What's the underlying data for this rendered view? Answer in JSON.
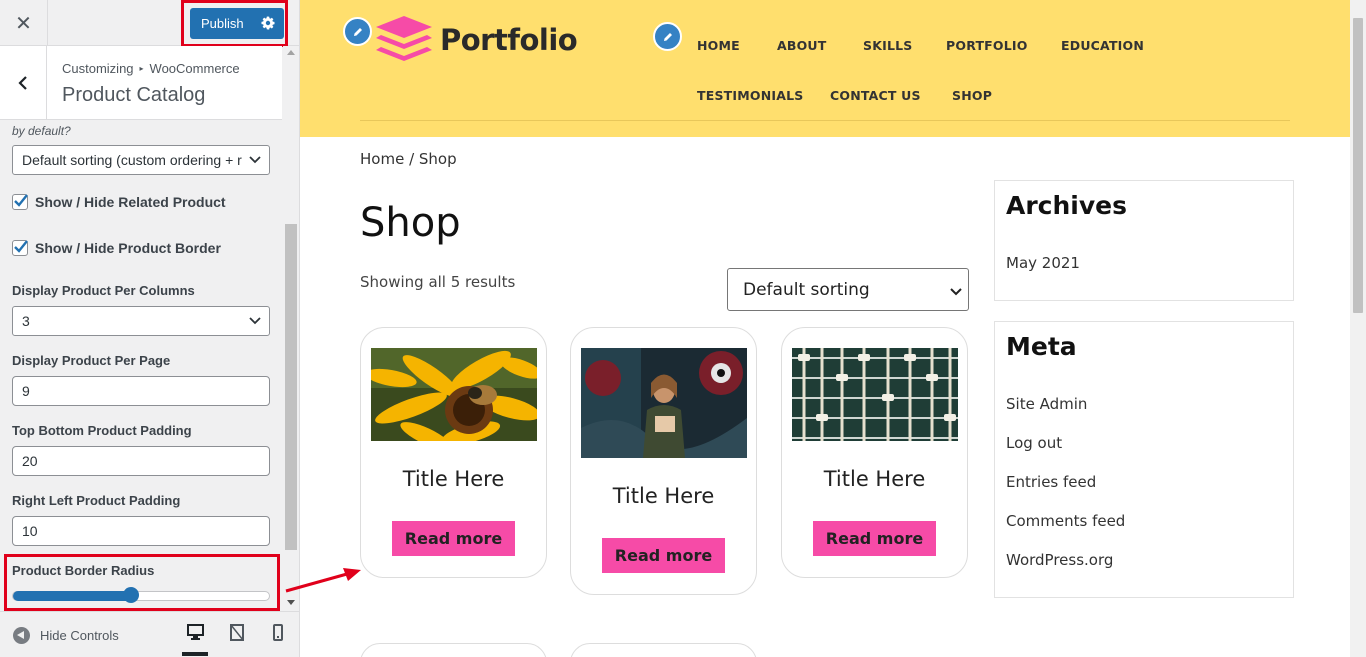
{
  "customizer": {
    "close_label": "✕",
    "publish_label": "Publish",
    "breadcrumb": [
      "Customizing",
      "WooCommerce"
    ],
    "section_title": "Product Catalog",
    "controls": {
      "sorting_hint": "by default?",
      "sorting_value": "Default sorting (custom ordering + r",
      "related_label": "Show / Hide Related Product",
      "border_label": "Show / Hide Product Border",
      "columns_label": "Display Product Per Columns",
      "columns_value": "3",
      "per_page_label": "Display Product Per Page",
      "per_page_value": "9",
      "tb_padding_label": "Top Bottom Product Padding",
      "tb_padding_value": "20",
      "rl_padding_label": "Right Left Product Padding",
      "rl_padding_value": "10",
      "radius_label": "Product Border Radius",
      "radius_fraction": 0.46
    },
    "footer": {
      "hide_controls": "Hide Controls",
      "devices": [
        "desktop-icon",
        "tablet-icon",
        "mobile-icon"
      ]
    }
  },
  "site": {
    "logo_text": "Portfolio",
    "nav": [
      "HOME",
      "ABOUT",
      "SKILLS",
      "PORTFOLIO",
      "EDUCATION",
      "TESTIMONIALS",
      "CONTACT US",
      "SHOP"
    ],
    "breadcrumb": "Home / Shop",
    "page_title": "Shop",
    "result_count": "Showing all 5 results",
    "sort_value": "Default sorting",
    "products": [
      {
        "title": "Title Here",
        "button": "Read more",
        "image": "yellow-flower-bee"
      },
      {
        "title": "Title Here",
        "button": "Read more",
        "image": "woman-graffiti-wall"
      },
      {
        "title": "Title Here",
        "button": "Read more",
        "image": "abacus-green"
      }
    ],
    "widgets": {
      "archives": {
        "title": "Archives",
        "links": [
          "May 2021"
        ]
      },
      "meta": {
        "title": "Meta",
        "links": [
          "Site Admin",
          "Log out",
          "Entries feed",
          "Comments feed",
          "WordPress.org"
        ]
      }
    }
  },
  "colors": {
    "header_bg": "#ffdf6e",
    "button_pink": "#f64ba7",
    "wp_blue": "#2271b1",
    "highlight_red": "#e0001b"
  }
}
